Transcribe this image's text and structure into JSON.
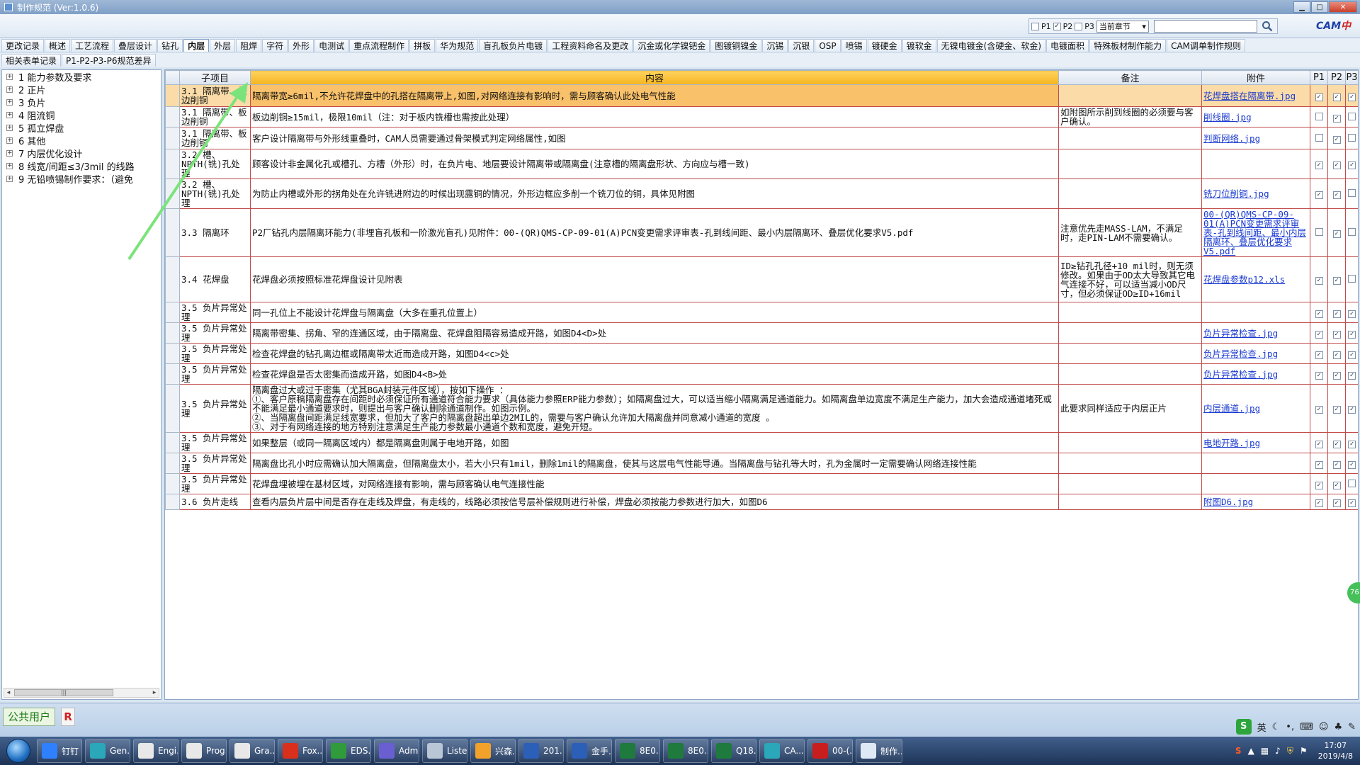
{
  "window": {
    "title": "制作规范 (Ver:1.0.6)"
  },
  "toolbar": {
    "filters": [
      {
        "label": "P1",
        "checked": false
      },
      {
        "label": "P2",
        "checked": true
      },
      {
        "label": "P3",
        "checked": false
      }
    ],
    "chapter_select": "当前章节",
    "search_value": "",
    "logo_text_1": "CAM",
    "logo_text_2": "中心"
  },
  "tabs_row1": [
    "更改记录",
    "概述",
    "工艺流程",
    "叠层设计",
    "钻孔",
    "内层",
    "外层",
    "阻焊",
    "字符",
    "外形",
    "电测试",
    "重点流程制作",
    "拼板",
    "华为规范",
    "盲孔板负片电镀",
    "工程资料命名及更改",
    "沉金或化学镍钯金",
    "图镀铜镍金",
    "沉锡",
    "沉银",
    "OSP",
    "喷锡",
    "镀硬金",
    "镀软金",
    "无镍电镀金(含硬金、软金)",
    "电镀面积",
    "特殊板材制作能力",
    "CAM调单制作规则"
  ],
  "active_tab": "内层",
  "tabs_row2": [
    "相关表单记录",
    "P1-P2-P3-P6规范差异"
  ],
  "tree": [
    "1 能力参数及要求",
    "2 正片",
    "3 负片",
    "4 阻流铜",
    "5 孤立焊盘",
    "6 其他",
    "7 内层优化设计",
    "8 线宽/间距≤3/3mil 的线路",
    "9 无铅喷锡制作要求：（避免"
  ],
  "grid": {
    "headers": {
      "sub": "子项目",
      "content": "内容",
      "remark": "备注",
      "attach": "附件",
      "p1": "P1",
      "p2": "P2",
      "p3": "P3"
    },
    "rows": [
      {
        "sub": "3.1 隔离带、板边削铜",
        "content": "隔离带宽≥6mil,不允许花焊盘中的孔搭在隔离带上,如图,对网络连接有影响时，需与顾客确认此处电气性能",
        "remark": "",
        "attach": "花焊盘搭在隔离带.jpg",
        "p1": true,
        "p2": true,
        "p3": true
      },
      {
        "sub": "3.1 隔离带、板边削铜",
        "content": "板边削铜≥15mil，极限10mil（注：对于板内铣槽也需按此处理）",
        "remark": "如附图所示削到线圈的必须要与客户确认。",
        "attach": "削线圈.jpg",
        "p1": false,
        "p2": true,
        "p3": false
      },
      {
        "sub": "3.1 隔离带、板边削铜",
        "content": "客户设计隔离带与外形线重叠时，CAM人员需要通过骨架模式判定网络属性,如图",
        "remark": "",
        "attach": "判断网络.jpg",
        "p1": false,
        "p2": true,
        "p3": false
      },
      {
        "sub": "3.2 槽、NPTH(铣)孔处理",
        "content": "顾客设计非金属化孔或槽孔、方槽（外形）时，在负片电、地层要设计隔离带或隔离盘(注意槽的隔离盘形状、方向应与槽一致)",
        "remark": "",
        "attach": "",
        "p1": true,
        "p2": true,
        "p3": true
      },
      {
        "sub": "3.2 槽、NPTH(铣)孔处理",
        "content": "为防止内槽或外形的拐角处在允许铣进附边的时候出现露铜的情况，外形边框应多削一个铣刀位的铜，具体见附图",
        "remark": "",
        "attach": "铣刀位削铜.jpg",
        "p1": true,
        "p2": true,
        "p3": false
      },
      {
        "sub": "3.3 隔离环",
        "content": "P2厂钻孔内层隔离环能力(非埋盲孔板和一阶激光盲孔)见附件：00-(QR)QMS-CP-09-01(A)PCN变更需求评审表-孔到线间距、最小内层隔离环、叠层优化要求V5.pdf",
        "remark": "注意优先走MASS-LAM，不满足时，走PIN-LAM不需要确认。",
        "attach": "00-(QR)QMS-CP-09-01(A)PCN变更需求评审表-孔到线间距、最小内层隔离环、叠层优化要求V5.pdf",
        "p1": false,
        "p2": true,
        "p3": false
      },
      {
        "sub": "3.4 花焊盘",
        "content": "花焊盘必须按照标准花焊盘设计见附表",
        "remark": "ID≥钻孔孔径+10 mil时，则无须修改。如果由于OD太大导致其它电气连接不好，可以适当减小OD尺寸，但必须保证OD≥ID+16mil",
        "attach": "花焊盘参数p12.xls",
        "p1": true,
        "p2": true,
        "p3": false
      },
      {
        "sub": "3.5 负片异常处理",
        "content": "同一孔位上不能设计花焊盘与隔离盘（大多在重孔位置上）",
        "remark": "",
        "attach": "",
        "p1": true,
        "p2": true,
        "p3": true
      },
      {
        "sub": "3.5 负片异常处理",
        "content": "隔离带密集、拐角、窄的连通区域，由于隔离盘、花焊盘阻隔容易造成开路，如图D4<D>处",
        "remark": "",
        "attach": "负片异常检查.jpg",
        "p1": true,
        "p2": true,
        "p3": true
      },
      {
        "sub": "3.5 负片异常处理",
        "content": "检查花焊盘的钻孔离边框或隔离带太近而造成开路，如图D4<c>处",
        "remark": "",
        "attach": "负片异常检查.jpg",
        "p1": true,
        "p2": true,
        "p3": true
      },
      {
        "sub": "3.5 负片异常处理",
        "content": "检查花焊盘是否太密集而造成开路，如图D4<B>处",
        "remark": "",
        "attach": "负片异常检查.jpg",
        "p1": true,
        "p2": true,
        "p3": true
      },
      {
        "sub": "3.5 负片异常处理",
        "content": "隔离盘过大或过于密集（尤其BGA封装元件区域），按如下操作 ：\n①、客户原稿隔离盘存在间距时必须保证所有通道符合能力要求（具体能力参照ERP能力参数）；如隔离盘过大，可以适当缩小隔离满足通道能力。如隔离盘单边宽度不满足生产能力，加大会造成通道堵死或不能满足最小通道要求时，则提出与客户确认删除通道制作。如图示例。\n②、当隔离盘间距满足线宽要求，但加大了客户的隔离盘超出单边2MIL的，需要与客户确认允许加大隔离盘并同意减小通道的宽度 。\n③、对于有网络连接的地方特别注意满足生产能力参数最小通道个数和宽度，避免开短。",
        "remark": "此要求同样适应于内层正片",
        "attach": "内层通道.jpg",
        "p1": true,
        "p2": true,
        "p3": true
      },
      {
        "sub": "3.5 负片异常处理",
        "content": "如果整层（或同一隔离区域内）都是隔离盘则属于电地开路，如图",
        "remark": "",
        "attach": "电地开路.jpg",
        "p1": true,
        "p2": true,
        "p3": true
      },
      {
        "sub": "3.5 负片异常处理",
        "content": "隔离盘比孔小时应需确认加大隔离盘，但隔离盘太小，若大小只有1mil，删除1mil的隔离盘，使其与这层电气性能导通。当隔离盘与钻孔等大时，孔为金属时一定需要确认网络连接性能",
        "remark": "",
        "attach": "",
        "p1": true,
        "p2": true,
        "p3": true
      },
      {
        "sub": "3.5 负片异常处理",
        "content": "花焊盘埋被埋在基材区域，对网络连接有影响，需与顾客确认电气连接性能",
        "remark": "",
        "attach": "",
        "p1": true,
        "p2": true,
        "p3": false
      },
      {
        "sub": "3.6 负片走线",
        "content": "查看内层负片层中间是否存在走线及焊盘，有走线的，线路必须按信号层补偿规则进行补偿，焊盘必须按能力参数进行加大，如图D6",
        "remark": "",
        "attach": "附图D6.jpg",
        "p1": true,
        "p2": true,
        "p3": true
      }
    ]
  },
  "status": {
    "user": "公共用户",
    "r_label": "R",
    "ime_lang": "英"
  },
  "badge": {
    "value": "76"
  },
  "taskbar": {
    "items": [
      {
        "label": "钉钉",
        "icon": "dingtalk-icon",
        "color": "#2f80ff"
      },
      {
        "label": "Gen...",
        "icon": "eye-icon",
        "color": "#2aa7b8"
      },
      {
        "label": "Engi...",
        "icon": "x-window-icon",
        "color": "#e8e8e8"
      },
      {
        "label": "Prog...",
        "icon": "x-window-icon",
        "color": "#e8e8e8"
      },
      {
        "label": "Gra...",
        "icon": "x-window-icon",
        "color": "#e8e8e8"
      },
      {
        "label": "Fox...",
        "icon": "foxit-icon",
        "color": "#d8301c"
      },
      {
        "label": "EDS...",
        "icon": "eds-icon",
        "color": "#2f9b3a"
      },
      {
        "label": "Adm...",
        "icon": "disk-icon",
        "color": "#6a5fd1"
      },
      {
        "label": "Liste...",
        "icon": "list-icon",
        "color": "#b9c6d6"
      },
      {
        "label": "兴森...",
        "icon": "sun-icon",
        "color": "#f2a22b"
      },
      {
        "label": "201...",
        "icon": "word-icon",
        "color": "#2b5fb8"
      },
      {
        "label": "金手...",
        "icon": "word-icon",
        "color": "#2b5fb8"
      },
      {
        "label": "8E0...",
        "icon": "excel-icon",
        "color": "#1f7a3d"
      },
      {
        "label": "8E0...",
        "icon": "excel-icon",
        "color": "#1f7a3d"
      },
      {
        "label": "Q18...",
        "icon": "excel-icon",
        "color": "#1f7a3d"
      },
      {
        "label": "CA...",
        "icon": "eye-icon",
        "color": "#2aa7b8"
      },
      {
        "label": "00-(...",
        "icon": "pdf-icon",
        "color": "#c81e1e"
      },
      {
        "label": "制作...",
        "icon": "doc-window-icon",
        "color": "#dfe9f5"
      }
    ],
    "clock_time": "17:07",
    "clock_date": "2019/4/8"
  }
}
